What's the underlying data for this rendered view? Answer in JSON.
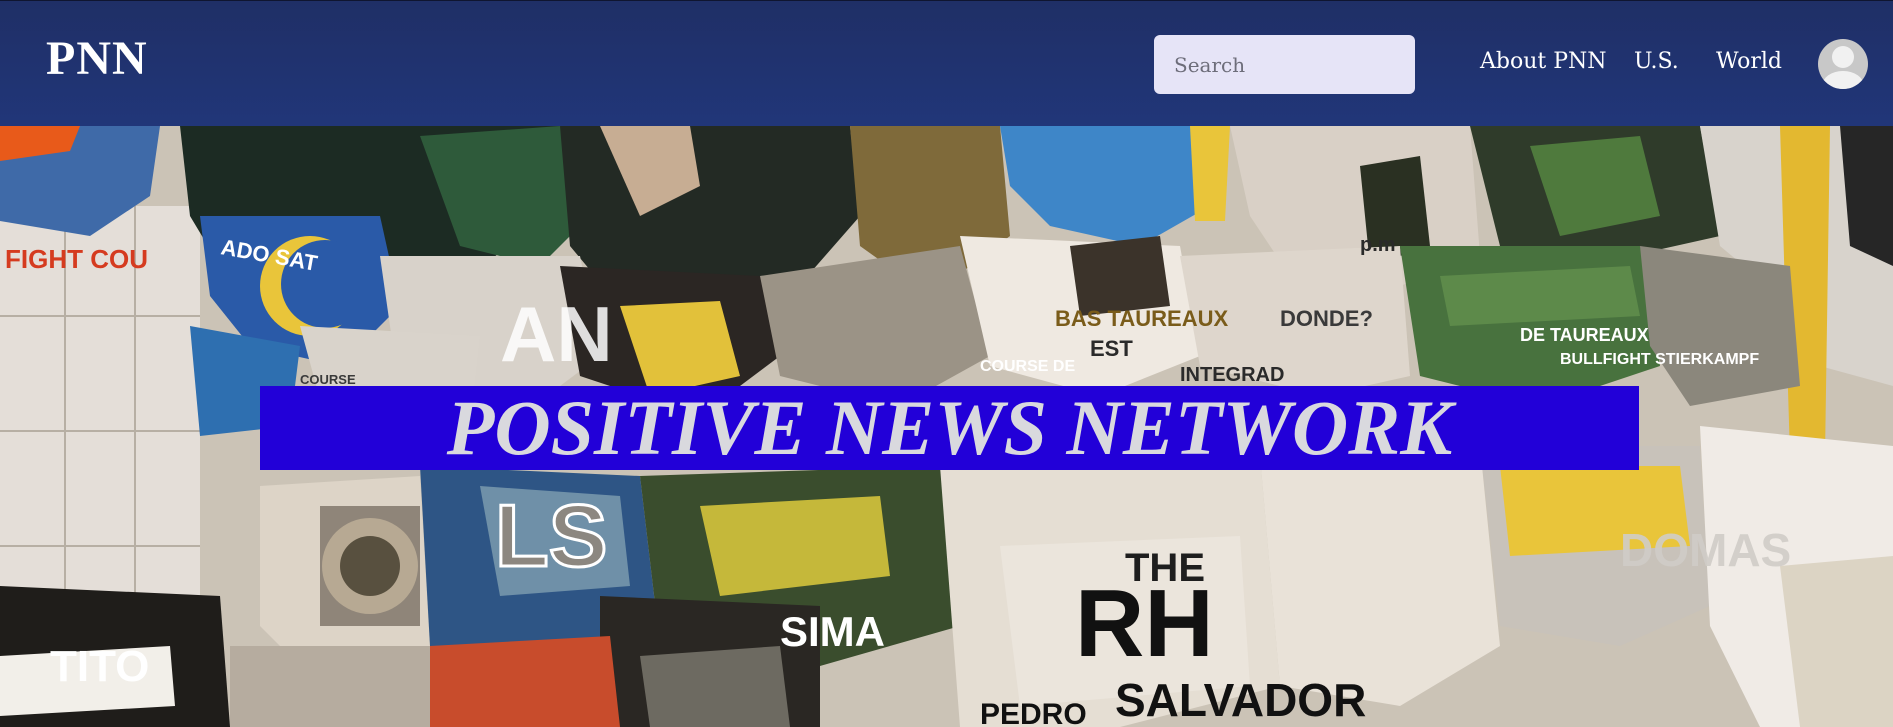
{
  "header": {
    "brand": "PNN",
    "search": {
      "placeholder": "Search",
      "value": ""
    },
    "nav": [
      {
        "label": "About PNN"
      },
      {
        "label": "U.S."
      },
      {
        "label": "World"
      }
    ],
    "avatar_icon": "user-avatar-icon"
  },
  "hero": {
    "banner_title": "POSITIVE NEWS NETWORK",
    "banner_color": "#2200d8",
    "poster_words": [
      "FIGHT COU",
      "ADO SAT",
      "AN",
      "BAS TAUREAUX",
      "DONDE?",
      "EST",
      "INTEGRAD",
      "COURSE DE",
      "DE TAUREAUX",
      "BULLFIGHT STIERKAMPF",
      "COURSE",
      "LS",
      "THE",
      "RH",
      "SALVADOR",
      "TITO",
      "PEDRO",
      "DOMAS",
      "SIMA",
      "p.m"
    ]
  },
  "colors": {
    "navbar": "#213679",
    "search_bg": "#e6e4f7",
    "banner": "#2200d8",
    "banner_text": "#d9d9de"
  }
}
